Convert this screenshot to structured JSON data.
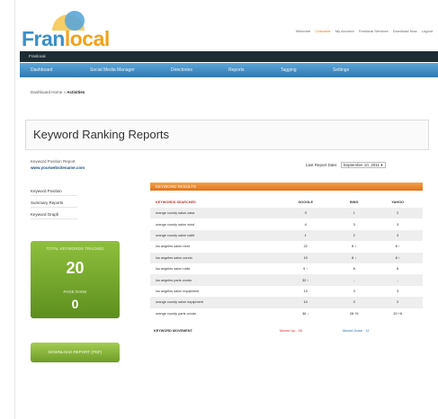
{
  "header": {
    "logo_part1": "Fran",
    "logo_part2": "local",
    "toplinks": [
      "Welcome",
      "My Account",
      "Franlocal Services",
      "Download Now",
      "Logout"
    ],
    "welcome_name": "Customer"
  },
  "blackbar": {
    "label": "Franlocal"
  },
  "nav": [
    "Dashboard",
    "Social Media Manager",
    "Directories",
    "Reports",
    "Tagging",
    "Settings"
  ],
  "breadcrumb": {
    "prefix": "Dashboard Home »",
    "current": "Activities"
  },
  "page": {
    "title": "Keyword Ranking Reports"
  },
  "report_info": {
    "label": "Keyword Position Report",
    "site": "www.yourwebsitename.com",
    "last_report_label": "Last Report Date:",
    "last_report_date": "September 10, 2011"
  },
  "sidebar": {
    "links": [
      "Keyword Position",
      "Summary Reports",
      "Keyword Graph"
    ],
    "stats": {
      "label1": "TOTAL KEYWORDS TRACKED",
      "value1": "20",
      "label2": "PAGE RANK",
      "value2": "0"
    },
    "download_label": "DOWNLOAD REPORT (PDF)"
  },
  "table": {
    "section_title": "KEYWORD RESULTS",
    "headers": [
      "KEYWORDS SEARCHED",
      "GOOGLE",
      "BING",
      "YAHOO"
    ],
    "rows": [
      [
        "orange county salon casa",
        "3",
        "1",
        "2"
      ],
      [
        "orange county salon wind",
        "4",
        "3",
        "3"
      ],
      [
        "orange county salon nailit",
        "1",
        "2",
        "3"
      ],
      [
        "los angeles salon near",
        "22",
        "8 ↑",
        "8 ↑"
      ],
      [
        "los angeles salon condo",
        "19",
        "8 ↑",
        "8 ↑"
      ],
      [
        "los angeles salon nails",
        "9 ↑",
        "8",
        "8"
      ],
      [
        "los angeles parts condo",
        "32 ↑",
        "-",
        "-"
      ],
      [
        "los angeles salon equipment",
        "13",
        "3",
        "3"
      ],
      [
        "orange county salon equipment",
        "14",
        "3",
        "2"
      ],
      [
        "orange county parts condo",
        "36 ↓",
        "28 +5",
        "20 +6"
      ]
    ],
    "footer": {
      "label": "KEYWORD MOVEMENT",
      "moved_up": "Moved Up : 28",
      "moved_down": "Moved Down : 12"
    }
  },
  "colors": {
    "nav_blue": "#2f78b2",
    "header_black": "#1d2b33",
    "accent_orange": "#e0731a",
    "panel_green": "#5d8f1f",
    "logo_blue": "#3b8fc9",
    "logo_orange": "#f2a21a"
  }
}
